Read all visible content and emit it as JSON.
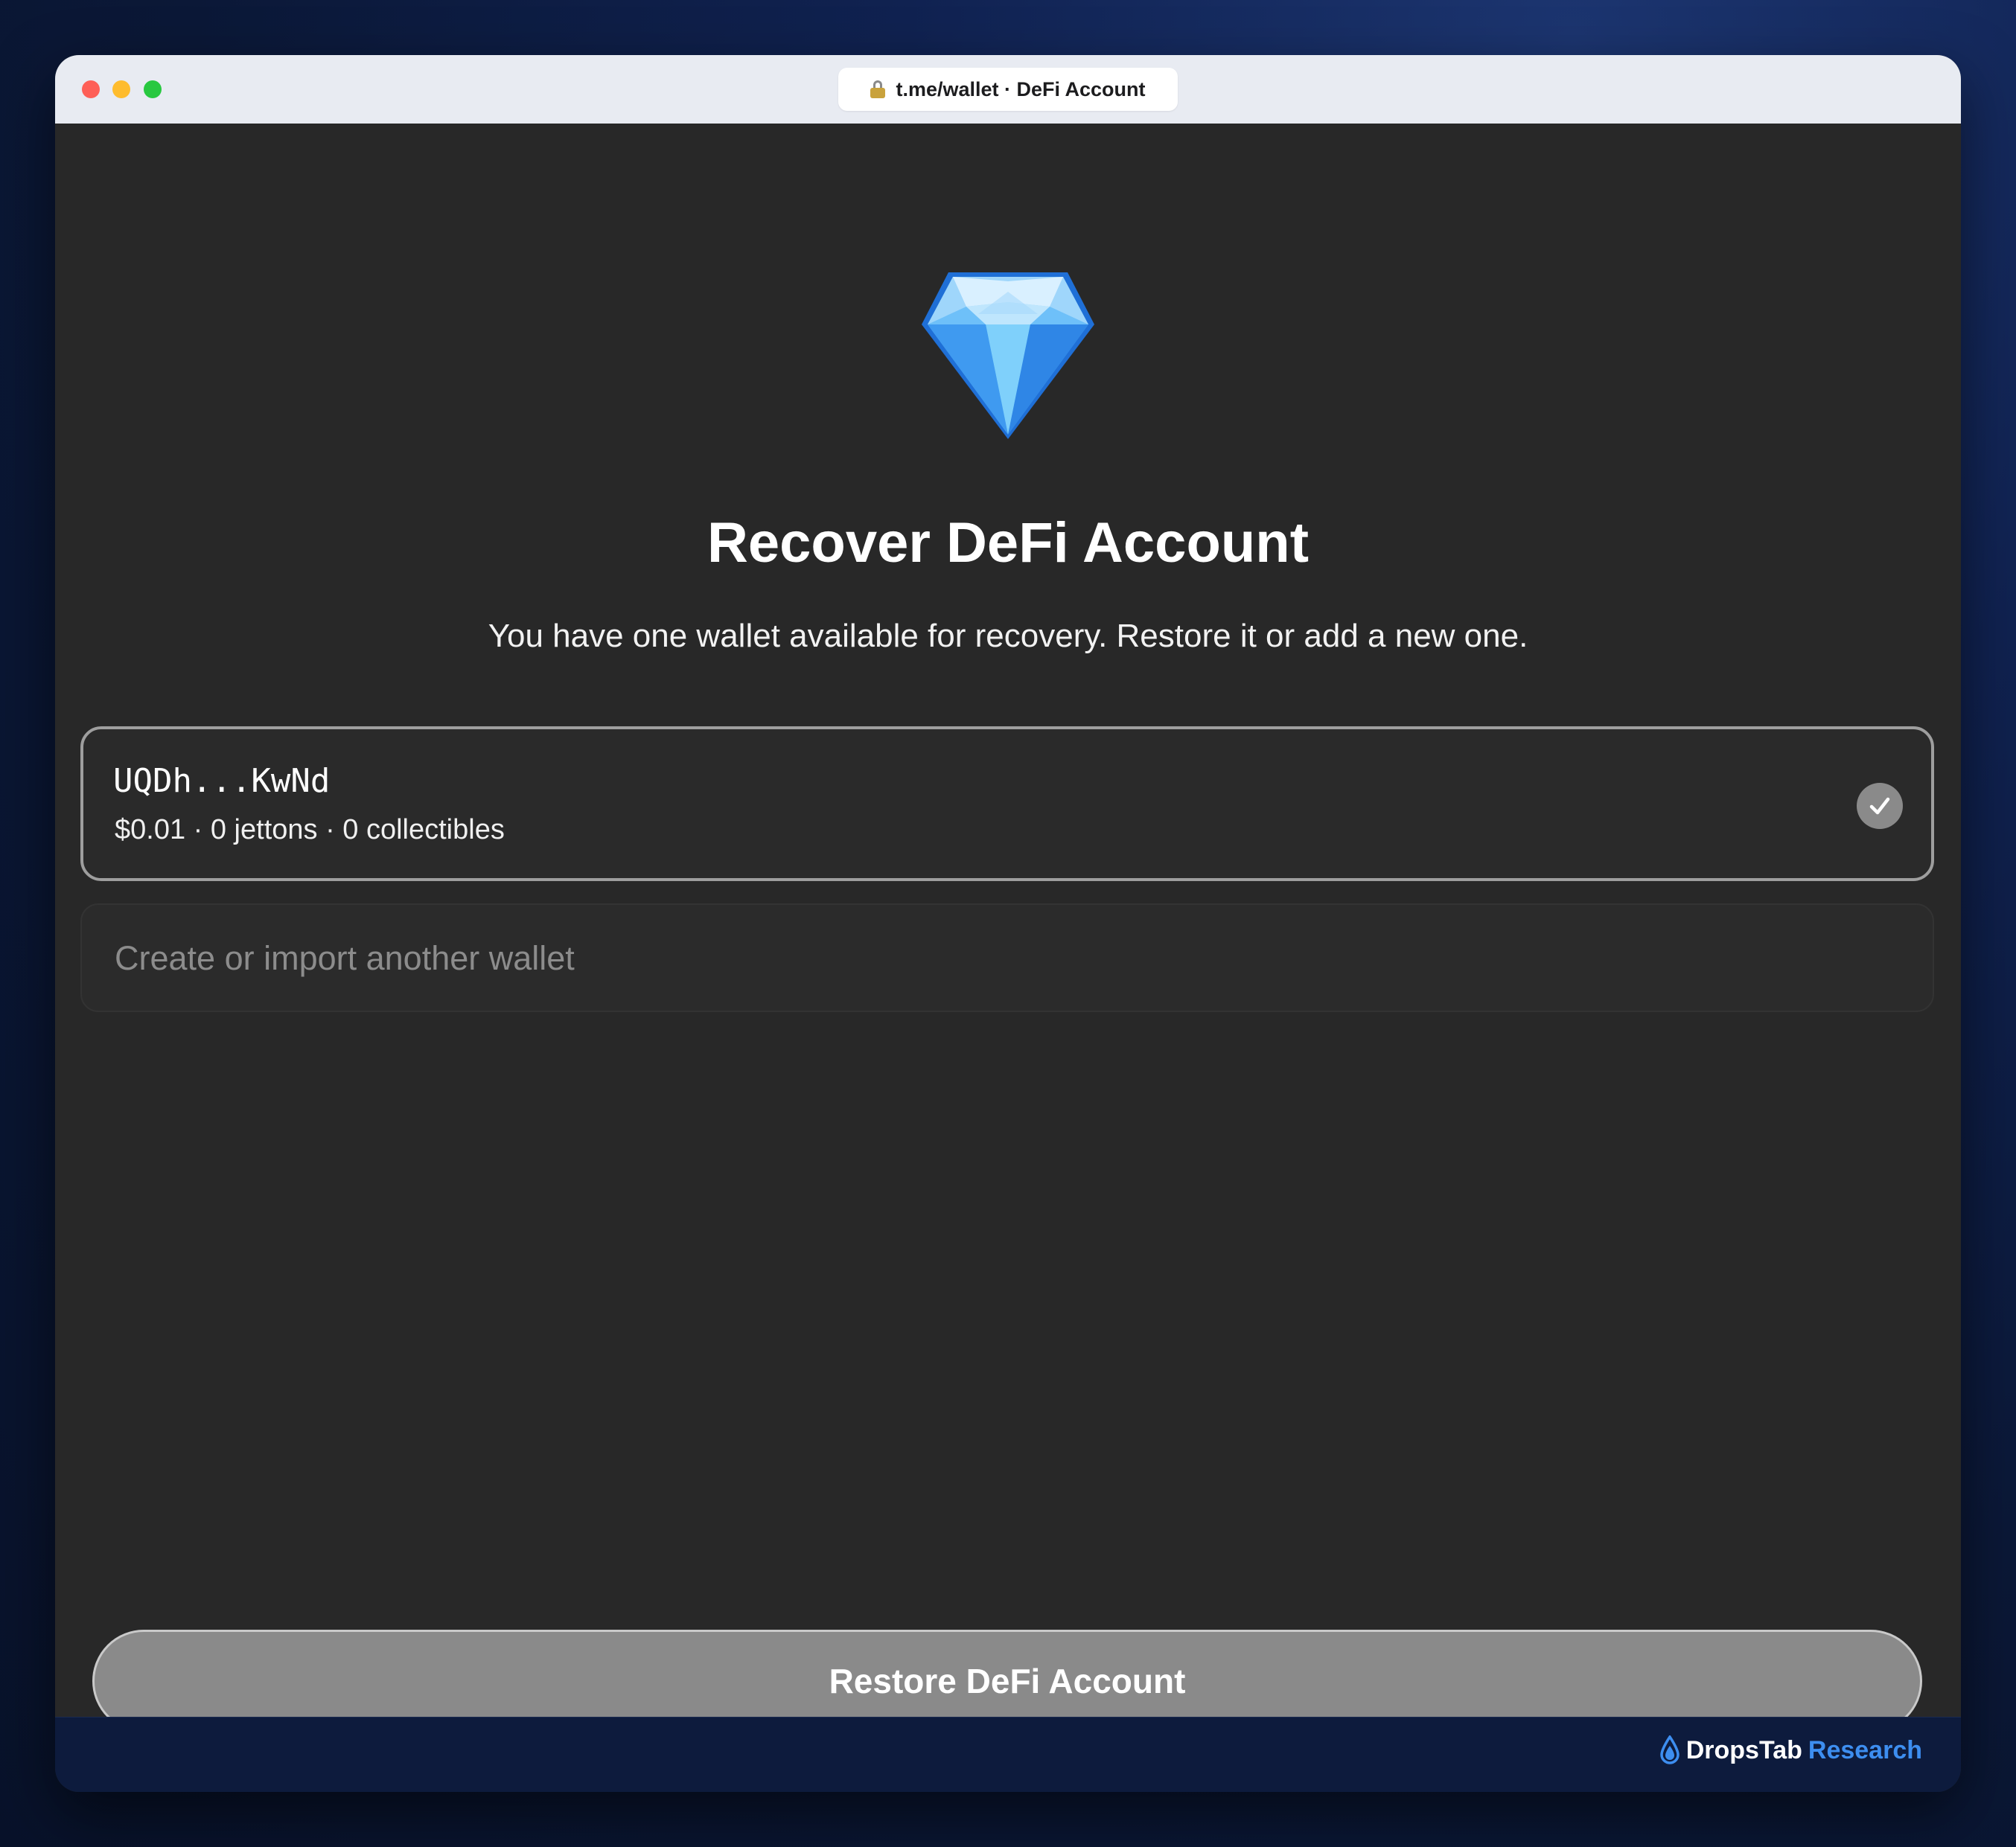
{
  "browser": {
    "url": "t.me/wallet · DeFi Account"
  },
  "page": {
    "title": "Recover DeFi Account",
    "subtitle": "You have one wallet available for recovery. Restore it or add a new one."
  },
  "wallet": {
    "address": "UQDh...KwNd",
    "meta": "$0.01 · 0 jettons · 0 collectibles",
    "selected": true
  },
  "create_option": {
    "label": "Create or import another wallet"
  },
  "actions": {
    "restore_label": "Restore DeFi Account"
  },
  "footer": {
    "brand_name": "DropsTab",
    "brand_sub": "Research"
  },
  "icons": {
    "gem": "gem-icon",
    "lock": "lock-icon",
    "check": "check-icon",
    "drop": "drop-icon"
  },
  "colors": {
    "background": "#282828",
    "button": "#8a8a8a",
    "brand_accent": "#3d8ef0",
    "gem_blue": "#4aa8f5"
  }
}
